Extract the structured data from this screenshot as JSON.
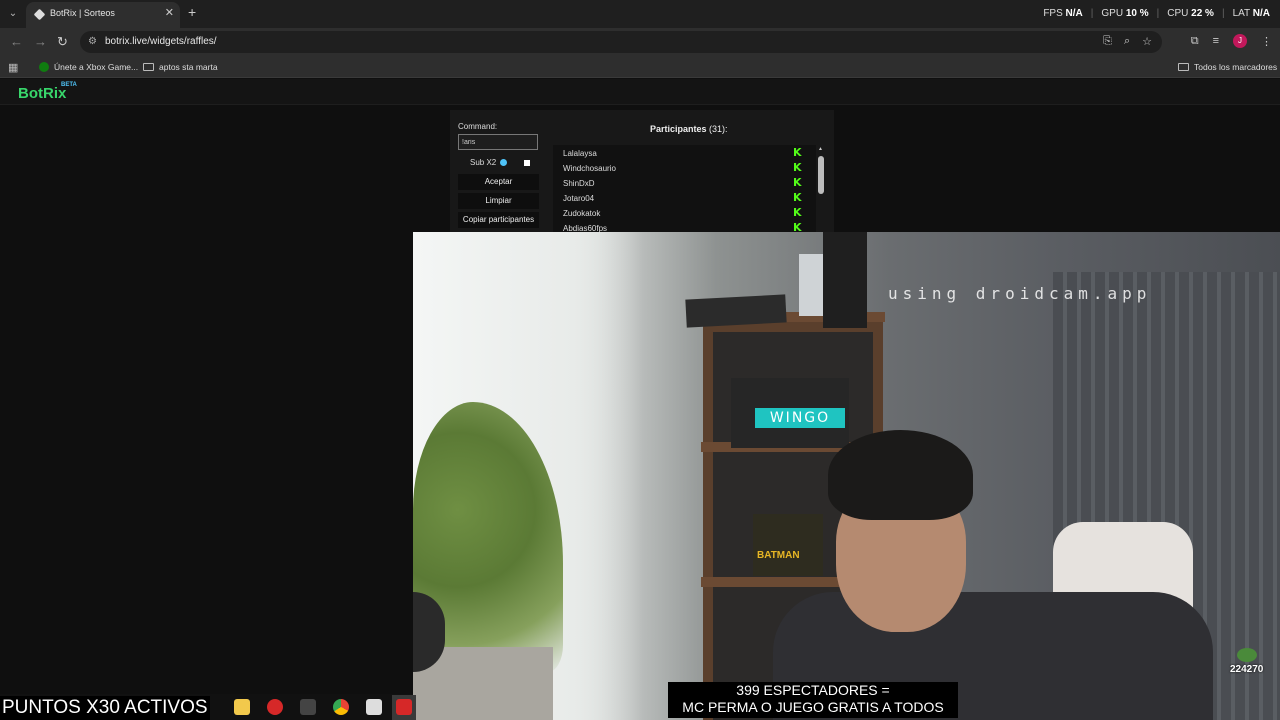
{
  "browser": {
    "tab_title": "BotRix | Sorteos",
    "tab_close": "✕",
    "new_tab": "+",
    "url": "botrix.live/widgets/raffles/",
    "perf": {
      "fps_label": "FPS",
      "fps_value": "N/A",
      "gpu_label": "GPU",
      "gpu_value": "10 %",
      "cpu_label": "CPU",
      "cpu_value": "22 %",
      "lat_label": "LAT",
      "lat_value": "N/A"
    },
    "bookmarks": [
      {
        "label": "Únete a Xbox Game..."
      },
      {
        "label": "aptos sta marta"
      }
    ],
    "all_bookmarks": "Todos los marcadores",
    "avatar_letter": "J"
  },
  "page": {
    "logo": "BotRix",
    "logo_tag": "BETA",
    "command_label": "Command:",
    "command_value": "!aris",
    "sub_label": "Sub X2",
    "buttons": {
      "accept": "Aceptar",
      "clear": "Limpiar",
      "copy": "Copiar participantes"
    },
    "participants_title": "Participantes",
    "participants_count": "(31):",
    "participants": [
      "Lalalaysa",
      "Windchosaurio",
      "ShinDxD",
      "Jotaro04",
      "Zudokatok",
      "Abdias60fps"
    ],
    "platform_mark": "K",
    "platform_color": "#53fc18"
  },
  "overlay": {
    "watermark": "using droidcam.app",
    "shelf_brand": "WINGO",
    "batman_text": "BATMAN",
    "points_count": "224270",
    "spectators_line1": "399 ESPECTADORES =",
    "spectators_line2": "MC PERMA O JUEGO GRATIS A TODOS",
    "points_banner": "PUNTOS X30 ACTIVOS"
  }
}
